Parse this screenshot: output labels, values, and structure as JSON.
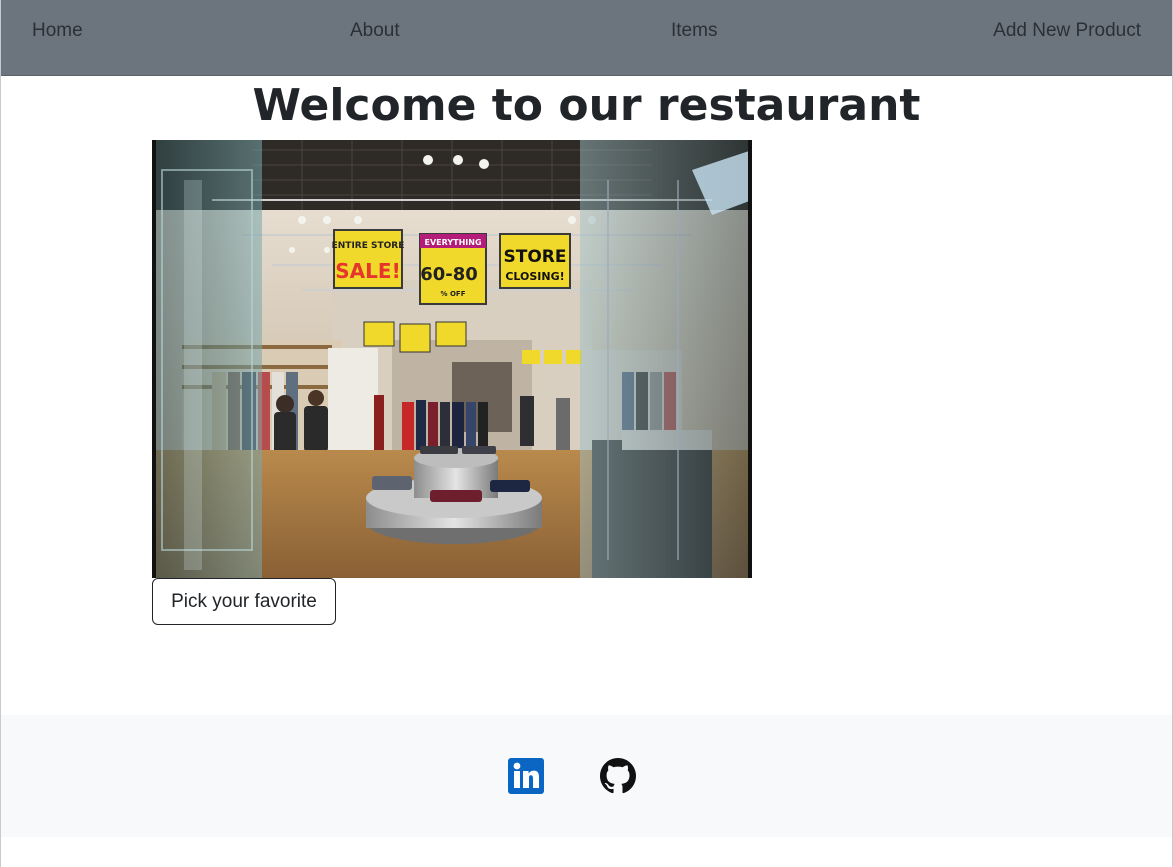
{
  "nav": {
    "home": "Home",
    "about": "About",
    "items": "Items",
    "add_new_product": "Add New Product"
  },
  "main": {
    "title": "Welcome to our restaurant",
    "image_signs": [
      "ENTIRE STORE",
      "SALE!",
      "EVERYTHING",
      "60-80",
      "% OFF",
      "STORE",
      "CLOSING!"
    ],
    "button_label": "Pick your favorite"
  },
  "footer": {
    "icons": [
      "linkedin-icon",
      "github-icon"
    ]
  },
  "colors": {
    "navbar": "#6c757d",
    "footer": "#f8f9fa",
    "linkedin": "#0a66c2",
    "text": "#212529"
  }
}
